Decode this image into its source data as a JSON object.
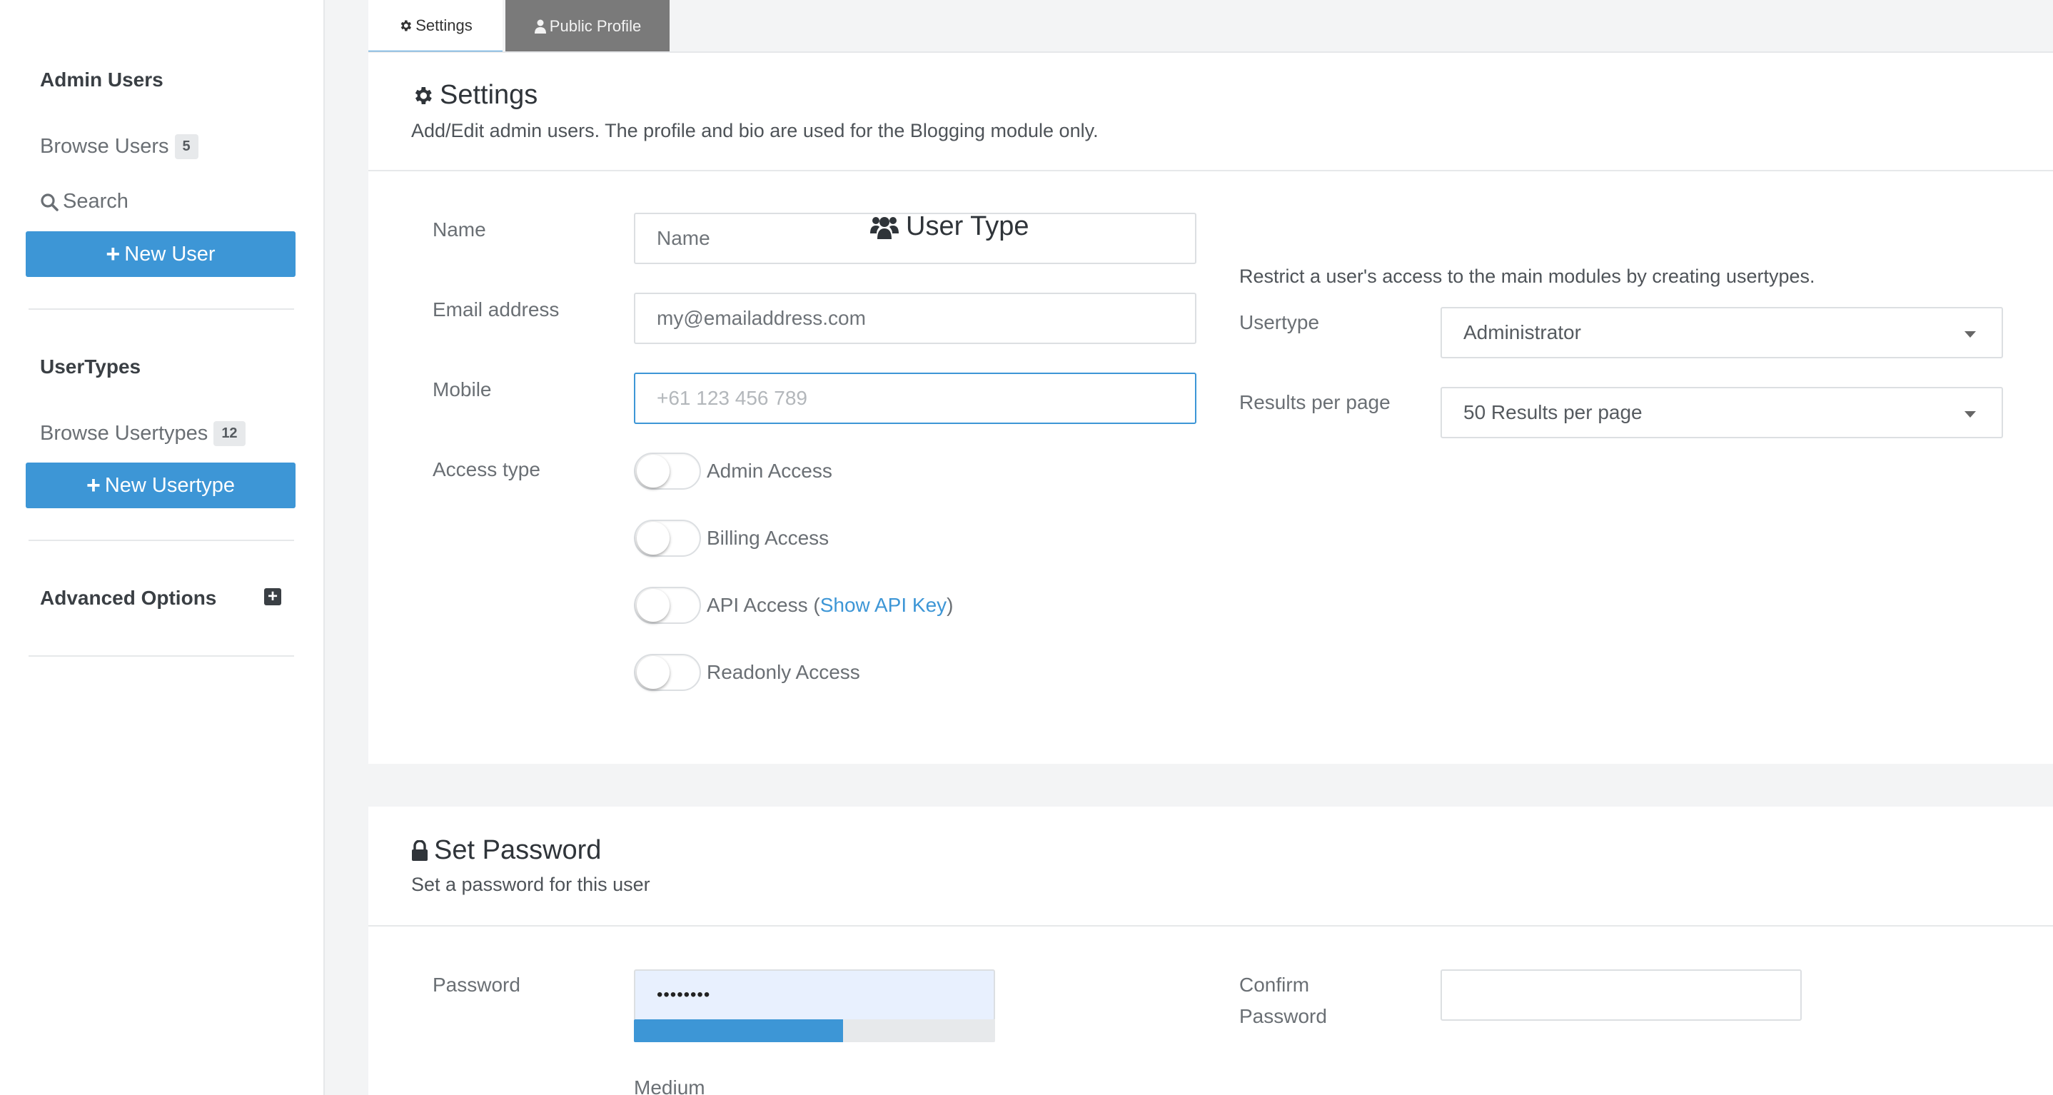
{
  "sidebar": {
    "admin_heading": "Admin Users",
    "browse_users": "Browse Users",
    "browse_users_count": "5",
    "search": "Search",
    "new_user": "New User",
    "usertypes_heading": "UserTypes",
    "browse_usertypes": "Browse Usertypes",
    "browse_usertypes_count": "12",
    "new_usertype": "New Usertype",
    "advanced_options": "Advanced Options"
  },
  "tabs": {
    "settings": "Settings",
    "public_profile": "Public Profile"
  },
  "settings": {
    "title": "Settings",
    "subtitle": "Add/Edit admin users. The profile and bio are used for the Blogging module only.",
    "name_label": "Name",
    "name_placeholder": "Name",
    "email_label": "Email address",
    "email_placeholder": "my@emailaddress.com",
    "mobile_label": "Mobile",
    "mobile_placeholder": "+61 123 456 789",
    "access_type_label": "Access type",
    "access": {
      "admin": "Admin Access",
      "billing": "Billing Access",
      "api_prefix": "API Access (",
      "api_link": "Show API Key",
      "api_suffix": ")",
      "readonly": "Readonly Access"
    }
  },
  "user_type": {
    "title": "User Type",
    "subtitle": "Restrict a user's access to the main modules by creating usertypes.",
    "usertype_label": "Usertype",
    "usertype_value": "Administrator",
    "results_label": "Results per page",
    "results_value": "50 Results per page"
  },
  "password": {
    "title": "Set Password",
    "subtitle": "Set a password for this user",
    "password_label": "Password",
    "password_value": "••••••••",
    "confirm_label_1": "Confirm",
    "confirm_label_2": "Password",
    "strength": 0.58,
    "strength_label": "Medium"
  },
  "colors": {
    "accent": "#3d96d6",
    "tab_inactive": "#7a7a7a"
  }
}
